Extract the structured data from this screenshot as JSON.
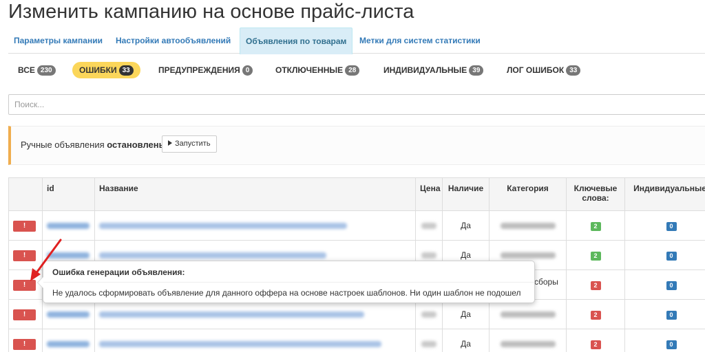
{
  "page_title": "Изменить кампанию на основе прайс-листа",
  "tabs": [
    {
      "label": "Параметры кампании"
    },
    {
      "label": "Настройки автообъявлений"
    },
    {
      "label": "Объявления по товарам"
    },
    {
      "label": "Метки для систем статистики"
    }
  ],
  "filters": [
    {
      "label": "ВСЕ",
      "count": "230"
    },
    {
      "label": "ОШИБКИ",
      "count": "33"
    },
    {
      "label": "ПРЕДУПРЕЖДЕНИЯ",
      "count": "0"
    },
    {
      "label": "ОТКЛЮЧЕННЫЕ",
      "count": "28"
    },
    {
      "label": "ИНДИВИДУАЛЬНЫЕ",
      "count": "39"
    },
    {
      "label": "ЛОГ ОШИБОК",
      "count": "33"
    }
  ],
  "search": {
    "placeholder": "Поиск..."
  },
  "alert": {
    "text_prefix": "Ручные объявления",
    "status": "остановлены",
    "period": ".",
    "run_label": "Запустить"
  },
  "table": {
    "headers": [
      "",
      "id",
      "Название",
      "Цена",
      "Наличие",
      "Категория",
      "Ключевые слова:",
      "Индивидуальные:"
    ],
    "error_label": "!",
    "rows": [
      {
        "availability": "Да",
        "keywords": "2",
        "individual": "0"
      },
      {
        "availability": "Да",
        "keywords": "2",
        "individual": "0"
      },
      {
        "availability": "",
        "keywords": "2",
        "individual": "0",
        "category_visible": "сборы"
      },
      {
        "availability": "Да",
        "keywords": "2",
        "individual": "0"
      },
      {
        "availability": "Да",
        "keywords": "2",
        "individual": "0"
      }
    ]
  },
  "tooltip": {
    "title": "Ошибка генерации объявления:",
    "body": "Не удалось сформировать объявление для данного оффера на основе настроек шаблонов. Ни один шаблон не подошел"
  },
  "colors": {
    "accent": "#337ab7",
    "active_filter": "#fbd65a",
    "error": "#d9534f",
    "success": "#5cb85c",
    "annotation": "#e02020"
  }
}
